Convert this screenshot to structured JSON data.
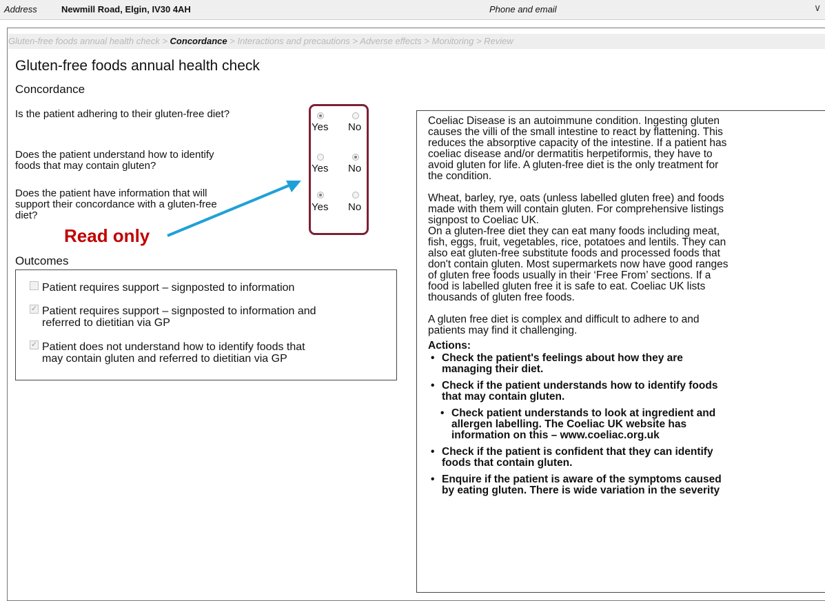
{
  "header": {
    "address_label": "Address",
    "address_value": "Newmill Road, Elgin, IV30 4AH",
    "phone_label": "Phone and email"
  },
  "breadcrumb": {
    "items": [
      "Gluten-free foods annual health check",
      "Concordance",
      "Interactions and precautions",
      "Adverse effects",
      "Monitoring",
      "Review"
    ],
    "separator": ">",
    "active_index": 1
  },
  "page": {
    "title": "Gluten-free foods annual health check",
    "section": "Concordance"
  },
  "questions": [
    {
      "text_line1": "Is the patient adhering to their gluten-free diet?",
      "text_line2": "",
      "text_line3": "",
      "yes_label": "Yes",
      "no_label": "No",
      "selected": "Yes"
    },
    {
      "text_line1": "Does the patient understand how to identify",
      "text_line2": "foods that may contain gluten?",
      "text_line3": "",
      "yes_label": "Yes",
      "no_label": "No",
      "selected": "No"
    },
    {
      "text_line1": "Does the patient have information that will",
      "text_line2": "support their concordance with a gluten-free",
      "text_line3": "diet?",
      "yes_label": "Yes",
      "no_label": "No",
      "selected": "Yes"
    }
  ],
  "annotation": {
    "label": "Read only",
    "color": "#c00000",
    "arrow_color": "#1fa0d8",
    "box_color": "#7b2135"
  },
  "outcomes": {
    "title": "Outcomes",
    "items": [
      {
        "line1": "Patient requires support – signposted to information",
        "line2": "",
        "checked": false
      },
      {
        "line1": "Patient requires support – signposted to information and",
        "line2": "referred to dietitian via GP",
        "checked": true
      },
      {
        "line1": "Patient does not understand how to identify foods that",
        "line2": "may contain gluten and referred to dietitian via GP",
        "checked": true
      }
    ]
  },
  "info": {
    "p1_lines": [
      "Coeliac Disease is an autoimmune condition. Ingesting gluten",
      "causes the villi of the small intestine to react by flattening. This",
      "reduces the absorptive capacity of the intestine. If a patient has",
      "coeliac disease and/or dermatitis herpetiformis, they have to",
      "avoid gluten for life. A gluten-free diet is the only treatment for",
      "the condition."
    ],
    "p2_lines": [
      "Wheat, barley, rye, oats (unless labelled gluten free) and foods",
      "made with them will contain gluten. For comprehensive listings",
      "signpost to Coeliac UK.",
      "On a gluten-free diet they can eat many foods including meat,",
      "fish, eggs, fruit, vegetables, rice, potatoes and lentils. They can",
      "also eat gluten-free substitute foods and processed foods that",
      "don't contain gluten. Most supermarkets now have good ranges",
      "of gluten free foods usually in their ‘Free From’ sections. If a",
      "food is labelled gluten free it is safe to eat. Coeliac UK lists",
      "thousands of gluten free foods."
    ],
    "p3_lines": [
      "A gluten free diet is complex and difficult to adhere to and",
      "patients may find it challenging."
    ],
    "actions_title": "Actions:",
    "actions": [
      {
        "lines": [
          "Check the patient's feelings about how they are",
          "managing their diet."
        ],
        "sub": false
      },
      {
        "lines": [
          "Check if the patient understands how to identify foods",
          "that may contain gluten."
        ],
        "sub": false
      },
      {
        "lines": [
          "Check patient understands to look at ingredient and",
          "allergen labelling. The Coeliac UK website has",
          "information on this – www.coeliac.org.uk"
        ],
        "sub": true
      },
      {
        "lines": [
          "Check if the patient is confident that they can identify",
          "foods that contain gluten."
        ],
        "sub": false
      },
      {
        "lines": [
          "Enquire if the patient is aware of the symptoms caused",
          "by eating gluten. There is wide variation in the severity"
        ],
        "sub": false
      }
    ]
  }
}
